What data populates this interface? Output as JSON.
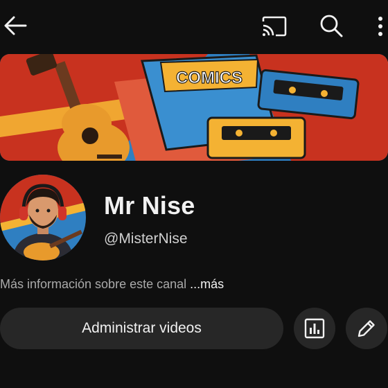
{
  "topbar": {
    "back_icon": "arrow-left-icon",
    "cast_icon": "cast-icon",
    "search_icon": "search-icon",
    "more_icon": "more-vertical-icon"
  },
  "banner": {
    "comic_title": "COMICS",
    "colors": {
      "red": "#c8321f",
      "blue": "#2f7fc1",
      "yellow": "#f4b233",
      "dark": "#1a1a1a"
    }
  },
  "channel": {
    "name": "Mr Nise",
    "handle": "@MisterNise",
    "description": "Más información sobre este canal",
    "more_label": "...más"
  },
  "actions": {
    "manage_label": "Administrar videos",
    "analytics_icon": "analytics-icon",
    "edit_icon": "pencil-icon"
  },
  "theme": {
    "background": "#0f0f0f",
    "surface": "#272727",
    "text_primary": "#f1f1f1",
    "text_secondary": "#aaaaaa"
  }
}
